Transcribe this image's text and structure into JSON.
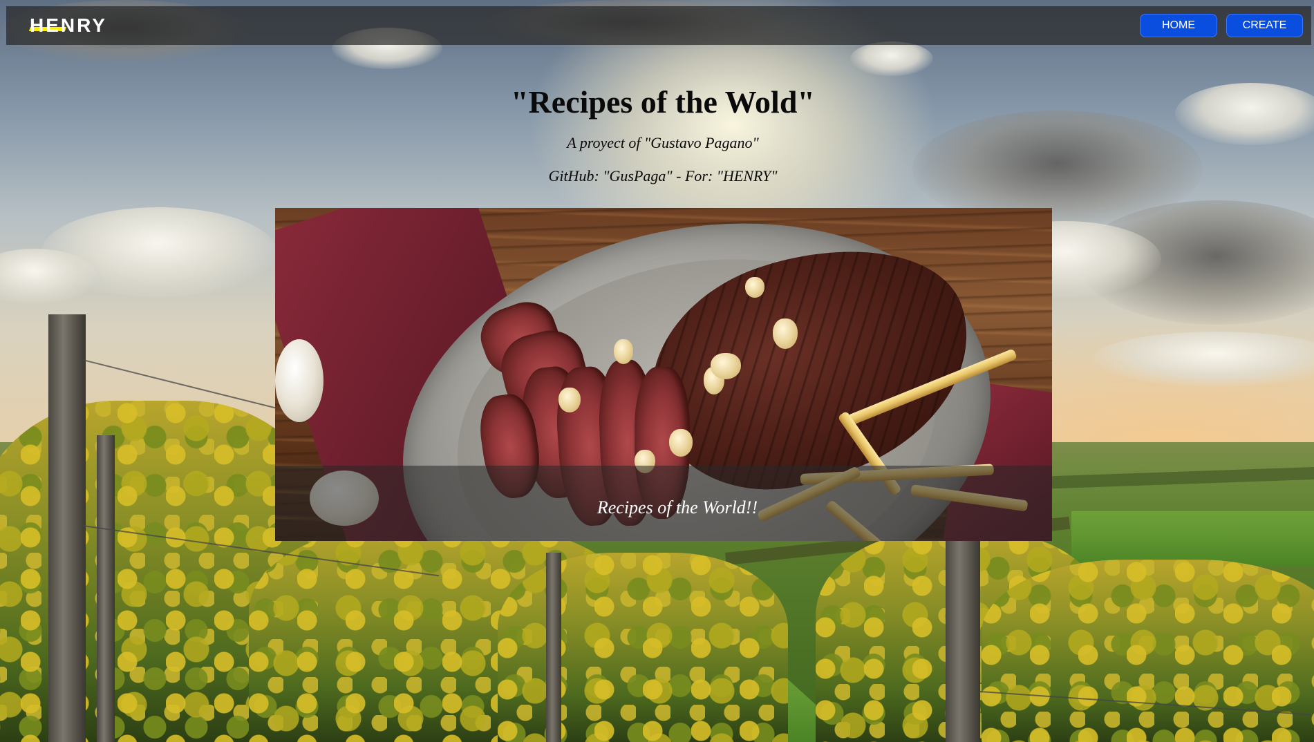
{
  "navbar": {
    "logo_text": "HENRY",
    "buttons": [
      {
        "label": "HOME"
      },
      {
        "label": "CREATE"
      }
    ],
    "button_color": "#0a4ee0",
    "logo_accent_color": "#ffee00"
  },
  "header": {
    "title": "\"Recipes of the Wold\"",
    "subtitle": "A proyect of \"Gustavo Pagano\"",
    "github_line": "GitHub: \"GusPaga\" - For: \"HENRY\""
  },
  "hero": {
    "caption": "Recipes of the World!!",
    "image_subject": "sliced steak with garlic and fries on a plate"
  },
  "background": {
    "image_subject": "vineyard rows under a sunset sky"
  }
}
